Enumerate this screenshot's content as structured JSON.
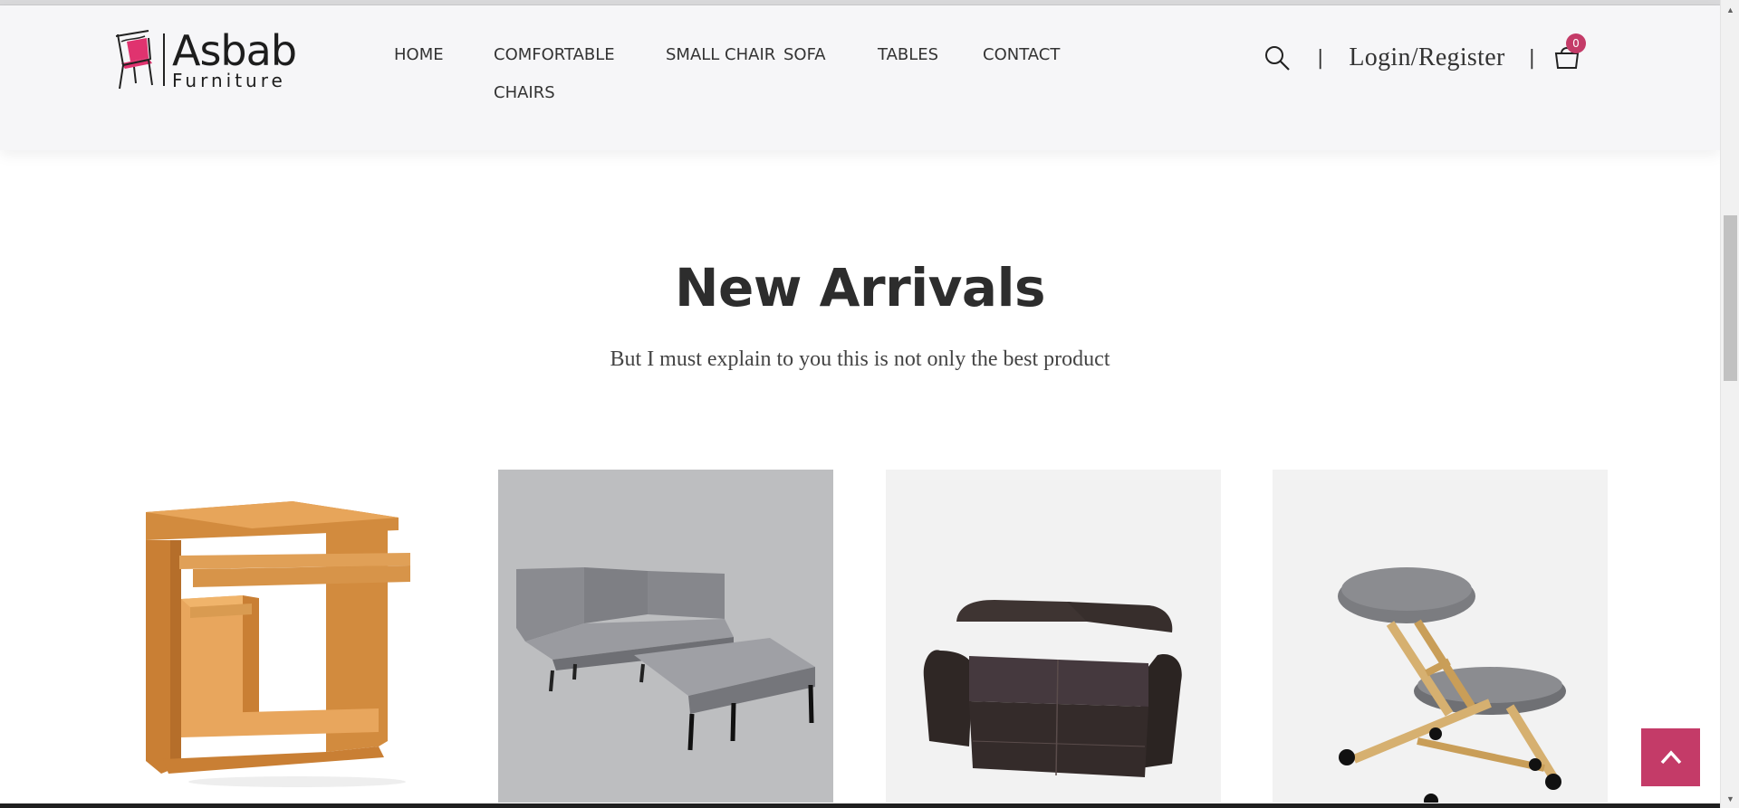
{
  "brand": {
    "name": "Asbab",
    "sub": "Furniture"
  },
  "nav": {
    "items": [
      {
        "label": "HOME"
      },
      {
        "label": "COMFORTABLE CHAIRS"
      },
      {
        "label": "SMALL CHAIR"
      },
      {
        "label": "SOFA"
      },
      {
        "label": "TABLES"
      },
      {
        "label": "CONTACT"
      }
    ]
  },
  "header_tools": {
    "search_icon": "search-icon",
    "separator": "|",
    "login_label": "Login/Register",
    "cart_icon": "shopping-bag-icon",
    "cart_count": "0"
  },
  "section": {
    "title": "New Arrivals",
    "subtitle": "But I must explain to you this is not only the best product"
  },
  "products": [
    {
      "image": "computer-desk"
    },
    {
      "image": "grey-modular-sofa"
    },
    {
      "image": "brown-leather-loveseat"
    },
    {
      "image": "kneeling-chair"
    }
  ],
  "back_to_top": {
    "icon": "chevron-up-icon"
  },
  "colors": {
    "accent": "#c43b68",
    "header_bg": "#f6f6f8",
    "text_dark": "#2d2d2d"
  }
}
